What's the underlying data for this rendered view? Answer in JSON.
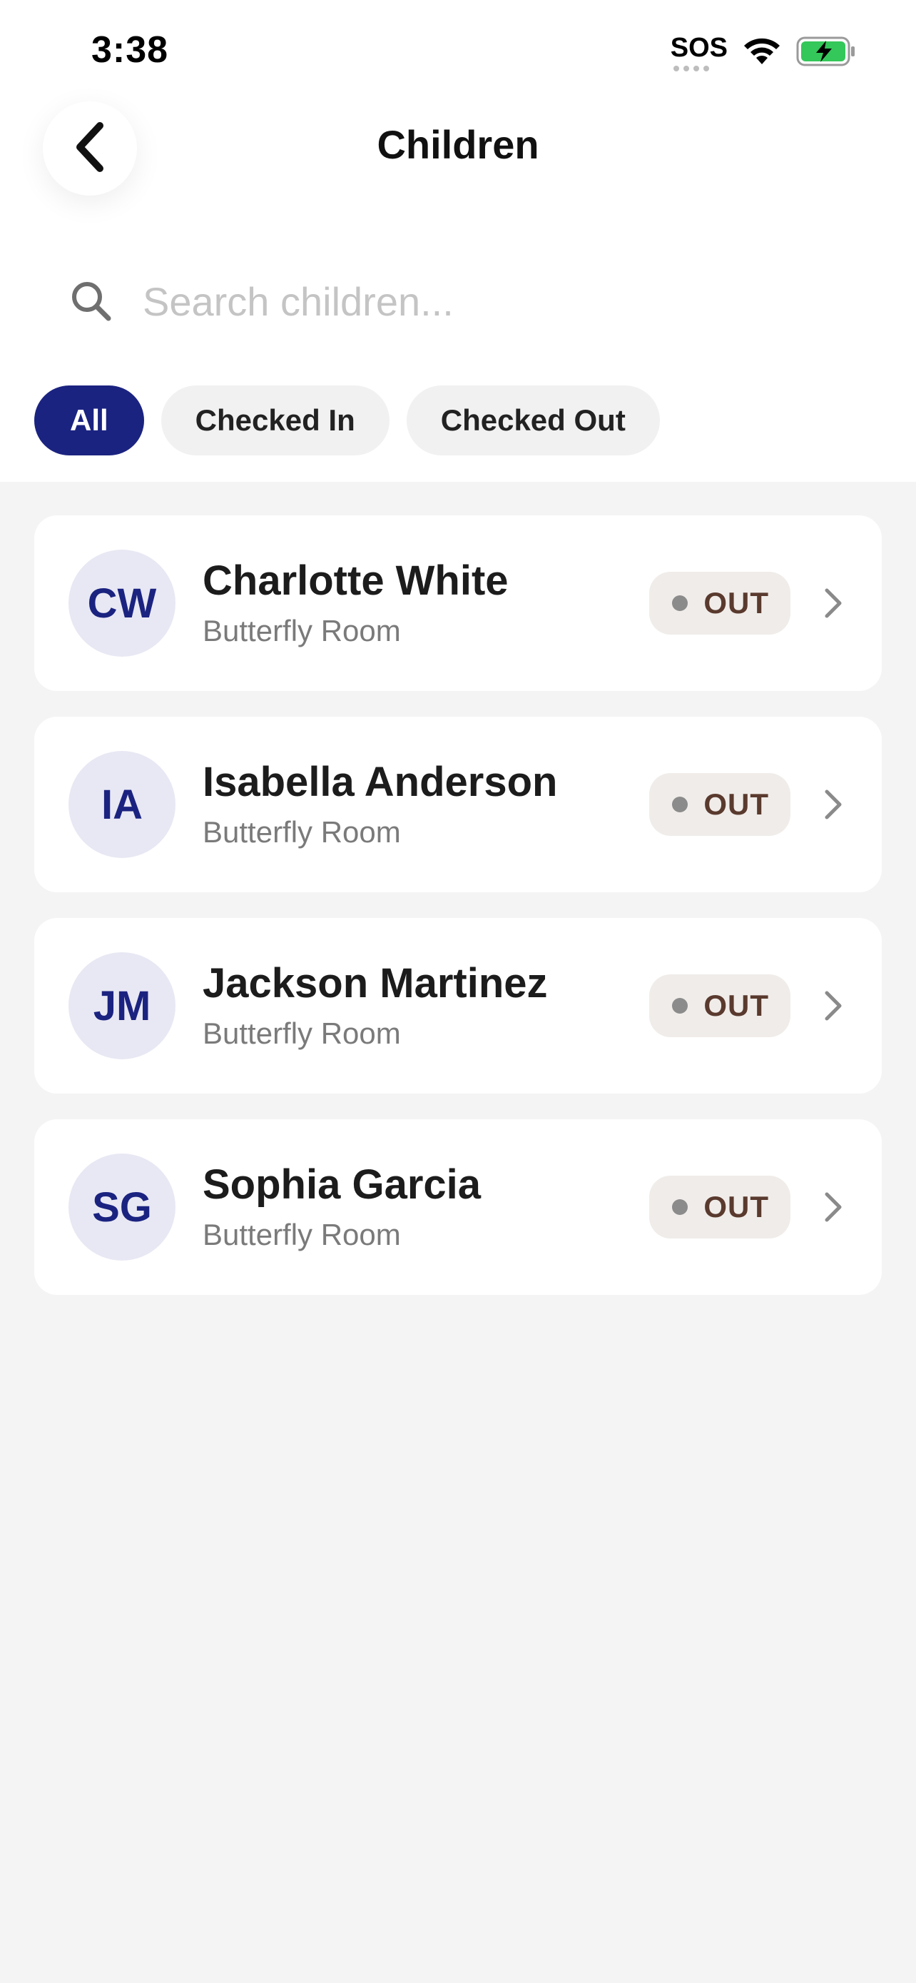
{
  "status_bar": {
    "time": "3:38",
    "sos": "SOS",
    "battery_color": "#34c759"
  },
  "header": {
    "title": "Children",
    "back_icon": "chevron-left-icon"
  },
  "search": {
    "placeholder": "Search children...",
    "value": "",
    "icon": "search-icon"
  },
  "filters": [
    {
      "label": "All",
      "active": true
    },
    {
      "label": "Checked In",
      "active": false
    },
    {
      "label": "Checked Out",
      "active": false
    }
  ],
  "children": [
    {
      "initials": "CW",
      "name": "Charlotte White",
      "room": "Butterfly Room",
      "status": "OUT"
    },
    {
      "initials": "IA",
      "name": "Isabella Anderson",
      "room": "Butterfly Room",
      "status": "OUT"
    },
    {
      "initials": "JM",
      "name": "Jackson Martinez",
      "room": "Butterfly Room",
      "status": "OUT"
    },
    {
      "initials": "SG",
      "name": "Sophia Garcia",
      "room": "Butterfly Room",
      "status": "OUT"
    }
  ],
  "colors": {
    "accent": "#1b2380",
    "avatar_bg": "#e8e8f4",
    "badge_bg": "#f0ece9",
    "badge_text": "#5a3a2e"
  }
}
